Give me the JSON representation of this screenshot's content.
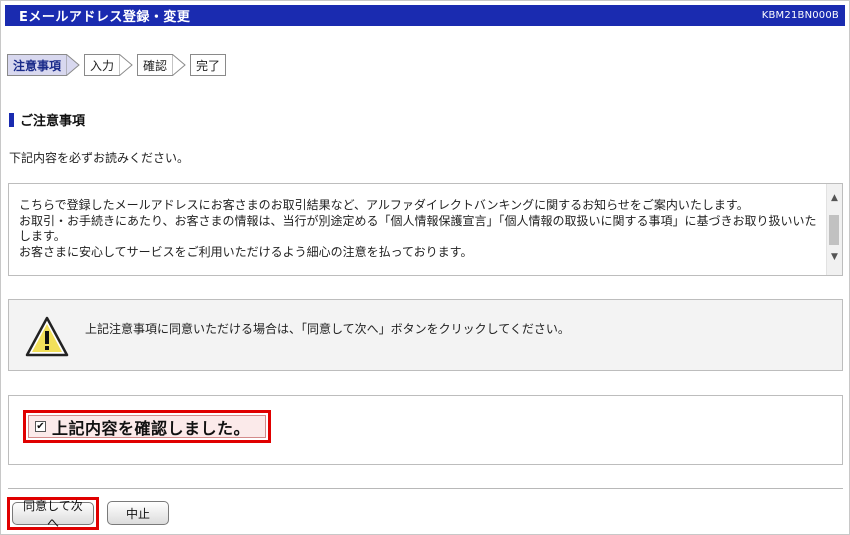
{
  "header": {
    "title": "Eメールアドレス登録・変更",
    "screen_code": "KBM21BN000B",
    "bg_color": "#1a2bb0"
  },
  "steps": [
    {
      "label": "注意事項",
      "active": true
    },
    {
      "label": "入力",
      "active": false
    },
    {
      "label": "確認",
      "active": false
    },
    {
      "label": "完了",
      "active": false
    }
  ],
  "section": {
    "title": "ご注意事項"
  },
  "instruction": "下記内容を必ずお読みください。",
  "notice": {
    "lines": [
      "こちらで登録したメールアドレスにお客さまのお取引結果など、アルファダイレクトバンキングに関するお知らせをご案内いたします。",
      "お取引・お手続きにあたり、お客さまの情報は、当行が別途定める「個人情報保護宣言」「個人情報の取扱いに関する事項」に基づきお取り扱いいたします。",
      "お客さまに安心してサービスをご利用いただけるよう細心の注意を払っております。"
    ]
  },
  "warning": {
    "icon": "warning-icon",
    "message": "上記注意事項に同意いただける場合は、「同意して次へ」ボタンをクリックしてください。"
  },
  "confirm": {
    "checked": true,
    "label": "上記内容を確認しました。",
    "highlight_color": "#e00000"
  },
  "buttons": {
    "agree_next": "同意して次へ",
    "cancel": "中止"
  }
}
